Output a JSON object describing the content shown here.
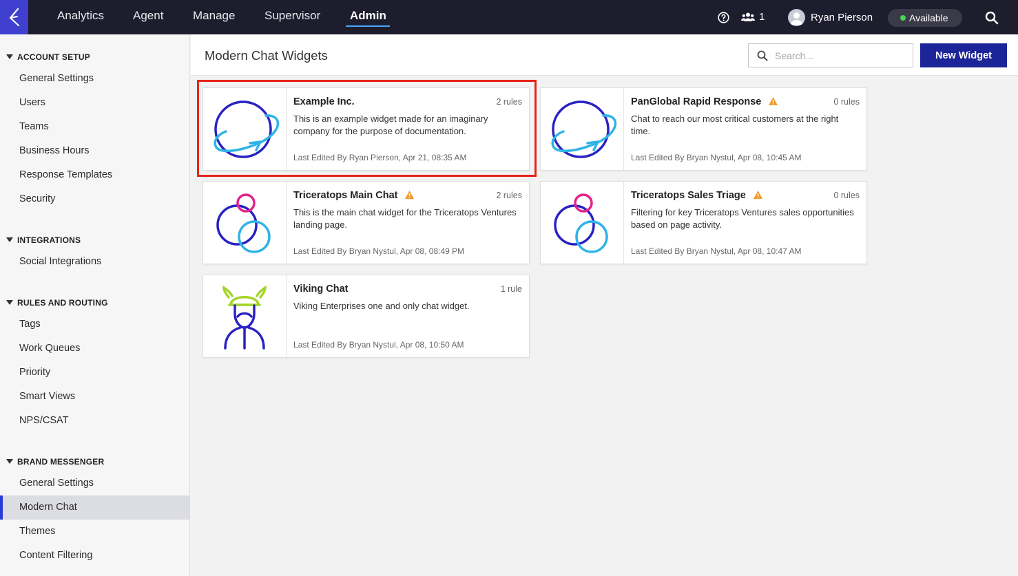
{
  "topbar": {
    "nav": [
      "Analytics",
      "Agent",
      "Manage",
      "Supervisor",
      "Admin"
    ],
    "active_tab": "Admin",
    "team_count": "1",
    "user_name": "Ryan Pierson",
    "status": "Available",
    "status_color": "#4cd35a",
    "accent": "#3f3fd0"
  },
  "sidebar": {
    "sections": [
      {
        "title": "ACCOUNT SETUP",
        "items": [
          "General Settings",
          "Users",
          "Teams",
          "Business Hours",
          "Response Templates",
          "Security"
        ]
      },
      {
        "title": "INTEGRATIONS",
        "items": [
          "Social Integrations"
        ]
      },
      {
        "title": "RULES AND ROUTING",
        "items": [
          "Tags",
          "Work Queues",
          "Priority",
          "Smart Views",
          "NPS/CSAT"
        ]
      },
      {
        "title": "BRAND MESSENGER",
        "items": [
          "General Settings",
          "Modern Chat",
          "Themes",
          "Content Filtering"
        ]
      }
    ],
    "active_item": "Modern Chat"
  },
  "header": {
    "title": "Modern Chat Widgets",
    "search_placeholder": "Search...",
    "new_button": "New Widget",
    "button_color": "#1c2597"
  },
  "widgets": [
    {
      "title": "Example Inc.",
      "rules": "2 rules",
      "desc": "This is an example widget made for an imaginary company for the purpose of documentation.",
      "edited": "Last Edited By Ryan Pierson, Apr 21, 08:35 AM",
      "icon": "planet-arrow-logo",
      "warning": false
    },
    {
      "title": "PanGlobal Rapid Response",
      "rules": "0 rules",
      "desc": "Chat to reach our most critical customers at the right time.",
      "edited": "Last Edited By Bryan Nystul, Apr 08, 10:45 AM",
      "icon": "planet-arrow-logo",
      "warning": true
    },
    {
      "title": "Triceratops Main Chat",
      "rules": "2 rules",
      "desc": "This is the main chat widget for the Triceratops Ventures landing page.",
      "edited": "Last Edited By Bryan Nystul, Apr 08, 08:49 PM",
      "icon": "three-circles-logo",
      "warning": true
    },
    {
      "title": "Triceratops Sales Triage",
      "rules": "0 rules",
      "desc": "Filtering for key Triceratops Ventures sales opportunities based on page activity.",
      "edited": "Last Edited By Bryan Nystul, Apr 08, 10:47 AM",
      "icon": "three-circles-logo",
      "warning": true
    },
    {
      "title": "Viking Chat",
      "rules": "1 rule",
      "desc": "Viking Enterprises one and only chat widget.",
      "edited": "Last Edited By Bryan Nystul, Apr 08, 10:50 AM",
      "icon": "viking-logo",
      "warning": false
    }
  ],
  "highlight_color": "#e8231a"
}
